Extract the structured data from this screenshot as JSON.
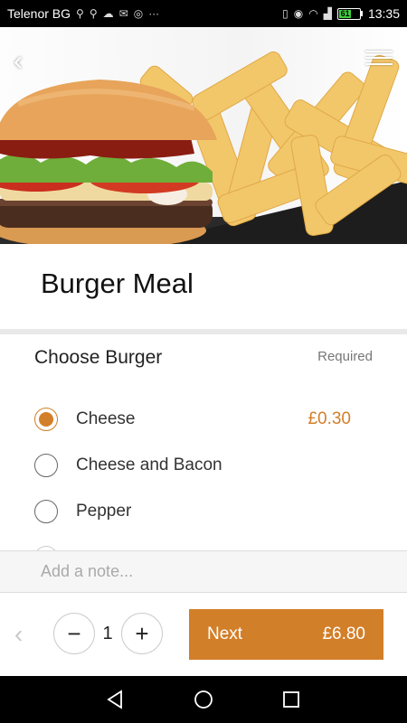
{
  "status_bar": {
    "carrier": "Telenor BG",
    "icons_left": [
      "usb-icon",
      "usb-icon",
      "cloud-icon",
      "mail-icon",
      "instagram-icon",
      "more-icon"
    ],
    "overflow_glyph": "···",
    "icons_right": [
      "vibrate-icon",
      "eye-icon",
      "wifi-icon",
      "signal-icon",
      "battery-icon"
    ],
    "battery_level": "61",
    "time": "13:35"
  },
  "hero": {
    "image_alt": "burger-and-fries-photo"
  },
  "header": {
    "back_icon": "‹",
    "menu_icon": "hamburger-menu-icon"
  },
  "product": {
    "title": "Burger Meal"
  },
  "section": {
    "title": "Choose Burger",
    "required_label": "Required",
    "options": [
      {
        "label": "Cheese",
        "price": "£0.30",
        "selected": true
      },
      {
        "label": "Cheese and Bacon",
        "price": "",
        "selected": false
      },
      {
        "label": "Pepper",
        "price": "",
        "selected": false
      }
    ]
  },
  "note": {
    "placeholder": "Add a note..."
  },
  "footer": {
    "prev_icon": "‹",
    "minus": "−",
    "quantity": "1",
    "plus": "+",
    "next_label": "Next",
    "total": "£6.80"
  },
  "colors": {
    "accent": "#d27f29",
    "status_bar": "#000000",
    "battery": "#3ecf3e"
  }
}
